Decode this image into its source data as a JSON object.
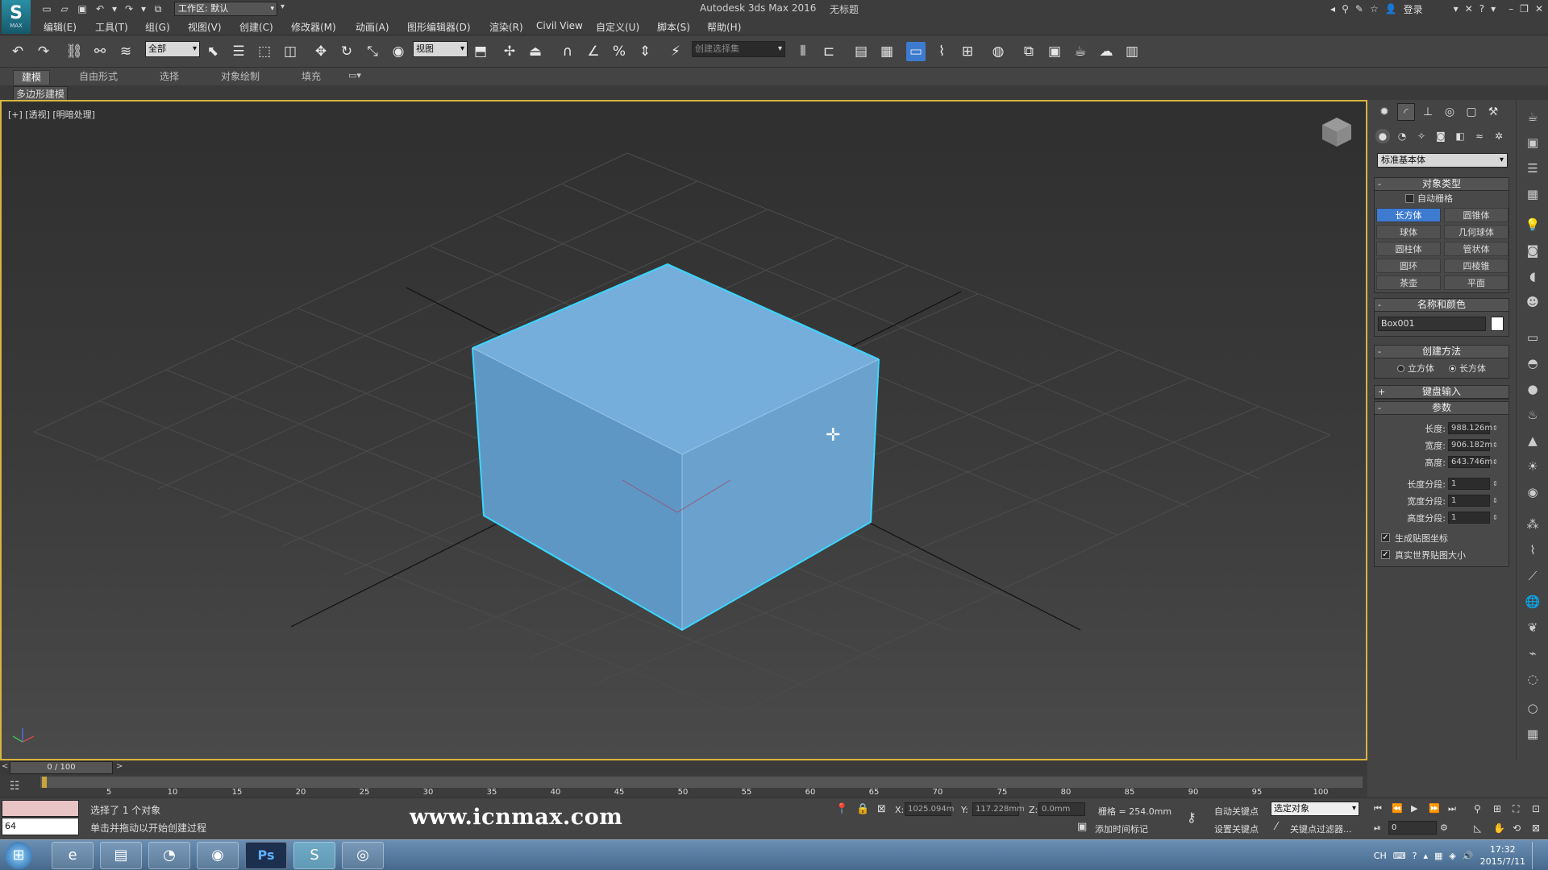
{
  "app": {
    "title": "Autodesk 3ds Max 2016",
    "doc_title": "无标题",
    "logo_caption": "MAX",
    "workspace": "工作区: 默认",
    "login": "登录"
  },
  "menu": [
    "编辑(E)",
    "工具(T)",
    "组(G)",
    "视图(V)",
    "创建(C)",
    "修改器(M)",
    "动画(A)",
    "图形编辑器(D)",
    "渲染(R)",
    "Civil View",
    "自定义(U)",
    "脚本(S)",
    "帮助(H)"
  ],
  "toolbar": {
    "filter_value": "全部",
    "ref_coord_value": "视图",
    "named_sel_placeholder": "创建选择集"
  },
  "ribbon": {
    "tabs": [
      "建模",
      "自由形式",
      "选择",
      "对象绘制",
      "填充"
    ],
    "active_tab": "建模",
    "sub_label": "多边形建模"
  },
  "viewport": {
    "label": "[+] [透视] [明暗处理]",
    "object_color": "#6fa8d6",
    "edge_color": "#39d3ff",
    "border_color": "#d7b53f"
  },
  "command_panel": {
    "category": "标准基本体",
    "object_type": {
      "title": "对象类型",
      "autogrid": "自动栅格",
      "buttons": [
        "长方体",
        "圆锥体",
        "球体",
        "几何球体",
        "圆柱体",
        "管状体",
        "圆环",
        "四棱锥",
        "茶壶",
        "平面"
      ],
      "active": "长方体"
    },
    "name_color": {
      "title": "名称和颜色",
      "name": "Box001",
      "color": "#ffffff"
    },
    "creation_method": {
      "title": "创建方法",
      "options": [
        "立方体",
        "长方体"
      ],
      "selected": "长方体"
    },
    "keyboard_entry": {
      "title": "键盘输入"
    },
    "parameters": {
      "title": "参数",
      "length_label": "长度:",
      "length": "988.126m",
      "width_label": "宽度:",
      "width": "906.182m",
      "height_label": "高度:",
      "height": "643.746m",
      "length_segs_label": "长度分段:",
      "length_segs": "1",
      "width_segs_label": "宽度分段:",
      "width_segs": "1",
      "height_segs_label": "高度分段:",
      "height_segs": "1",
      "gen_map_coords": "生成贴图坐标",
      "real_world_map": "真实世界贴图大小"
    }
  },
  "timeline": {
    "slider": "0 / 100",
    "ticks": [
      5,
      10,
      15,
      20,
      25,
      30,
      35,
      40,
      45,
      50,
      55,
      60,
      65,
      70,
      75,
      80,
      85,
      90,
      95,
      100
    ]
  },
  "status": {
    "maxscript_value": "64",
    "line1": "选择了 1 个对象",
    "line2": "单击并拖动以开始创建过程",
    "watermark": "www.icnmax.com",
    "x_label": "X:",
    "x": "1025.094m",
    "y_label": "Y:",
    "y": "117.228mm",
    "z_label": "Z:",
    "z": "0.0mm",
    "grid": "栅格 = 254.0mm",
    "add_time_tag": "添加时间标记",
    "auto_key": "自动关键点",
    "set_key": "设置关键点",
    "selection_set": "选定对象",
    "key_filters": "关键点过滤器...",
    "frame": "0"
  },
  "taskbar": {
    "ps_label": "Ps",
    "lang": "CH",
    "time": "17:32",
    "date": "2015/7/11"
  }
}
